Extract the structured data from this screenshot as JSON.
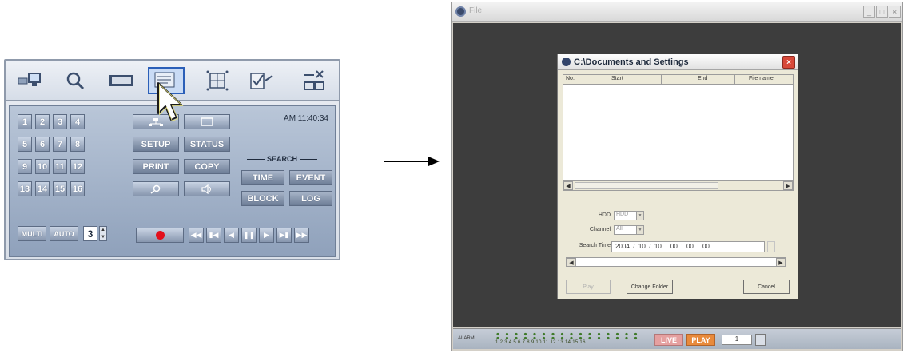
{
  "panel": {
    "clock": "AM 11:40:34",
    "numbers": [
      "1",
      "2",
      "3",
      "4",
      "5",
      "6",
      "7",
      "8",
      "9",
      "10",
      "11",
      "12",
      "13",
      "14",
      "15",
      "16"
    ],
    "buttons": {
      "setup": "SETUP",
      "status": "STATUS",
      "print": "PRINT",
      "copy": "COPY"
    },
    "search_heading": "SEARCH",
    "search_buttons": {
      "time": "TIME",
      "event": "EVENT",
      "block": "BLOCK",
      "log": "LOG"
    },
    "multi": "MULTI",
    "auto": "AUTO",
    "channel_value": "3",
    "record_color": "#e3101c",
    "toolbar_icons": [
      "monitor-icon",
      "search-icon",
      "tape-icon",
      "file-icon",
      "grid-icon",
      "checklist-icon",
      "minimize-close-icon"
    ]
  },
  "window": {
    "title": "File",
    "statusbar": {
      "alarm_label": "ALARM",
      "alarm_numbers": "1 2 3 4 5 6 7 8 9 10 11 12 13 14 15 16",
      "live": "LIVE",
      "play": "PLAY",
      "field_value": "1"
    }
  },
  "dialog": {
    "title": "C:\\Documents and Settings",
    "columns": [
      "No.",
      "Start",
      "End",
      "File name"
    ],
    "hdd_label": "HDD",
    "hdd_value": "HDD",
    "channel_label": "Channel",
    "channel_value": "All",
    "search_time_label": "Search Time",
    "search_time_value": "2004  /  10  /  10     00  :  00  :  00",
    "play_button": "Play",
    "change_folder_button": "Change Folder",
    "cancel_button": "Cancel"
  },
  "colors": {
    "live": "#e5a0a0",
    "play": "#e88a3b",
    "dialog_close": "#d8493a"
  }
}
